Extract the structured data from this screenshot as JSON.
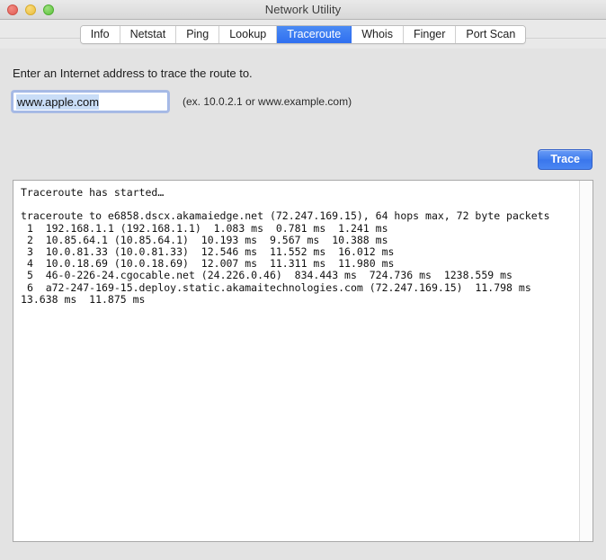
{
  "window": {
    "title": "Network Utility",
    "traffic_lights": [
      {
        "name": "close",
        "color": "#e25c54"
      },
      {
        "name": "minimize",
        "color": "#e8bd3f"
      },
      {
        "name": "zoom",
        "color": "#5ec23e"
      }
    ]
  },
  "tabs": [
    {
      "label": "Info",
      "active": false
    },
    {
      "label": "Netstat",
      "active": false
    },
    {
      "label": "Ping",
      "active": false
    },
    {
      "label": "Lookup",
      "active": false
    },
    {
      "label": "Traceroute",
      "active": true
    },
    {
      "label": "Whois",
      "active": false
    },
    {
      "label": "Finger",
      "active": false
    },
    {
      "label": "Port Scan",
      "active": false
    }
  ],
  "traceroute": {
    "prompt": "Enter an Internet address to trace the route to.",
    "address_value": "www.apple.com",
    "address_placeholder": "www.example.com",
    "hint": "(ex. 10.0.2.1 or www.example.com)",
    "trace_button": "Trace",
    "output": "Traceroute has started…\n\ntraceroute to e6858.dscx.akamaiedge.net (72.247.169.15), 64 hops max, 72 byte packets\n 1  192.168.1.1 (192.168.1.1)  1.083 ms  0.781 ms  1.241 ms\n 2  10.85.64.1 (10.85.64.1)  10.193 ms  9.567 ms  10.388 ms\n 3  10.0.81.33 (10.0.81.33)  12.546 ms  11.552 ms  16.012 ms\n 4  10.0.18.69 (10.0.18.69)  12.007 ms  11.311 ms  11.980 ms\n 5  46‑0‑226‑24.cgocable.net (24.226.0.46)  834.443 ms  724.736 ms  1238.559 ms\n 6  a72‑247‑169‑15.deploy.static.akamaitechnologies.com (72.247.169.15)  11.798 ms  13.638 ms  11.875 ms"
  },
  "colors": {
    "accent": "#3f7ced",
    "window_bg": "#e3e3e3",
    "tab_active_bg": "#2f6ff0",
    "selection_bg": "#c9ddf7"
  }
}
